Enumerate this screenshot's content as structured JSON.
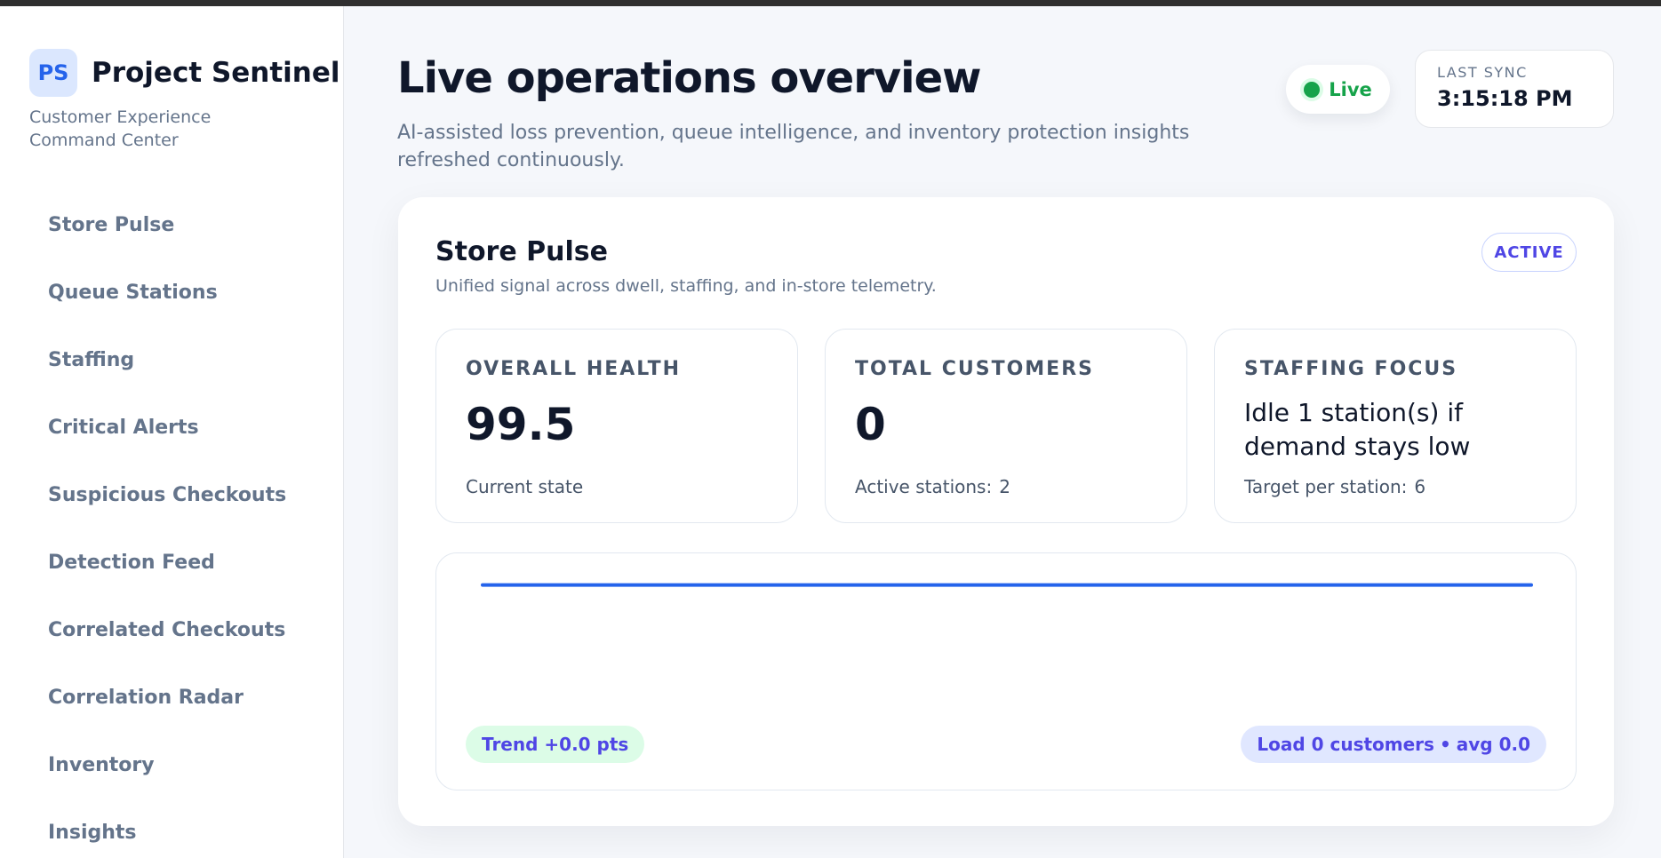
{
  "app": {
    "initials": "PS",
    "name": "Project Sentinel",
    "subtitle": "Customer Experience Command Center"
  },
  "sidebar": {
    "items": [
      {
        "label": "Store Pulse"
      },
      {
        "label": "Queue Stations"
      },
      {
        "label": "Staffing"
      },
      {
        "label": "Critical Alerts"
      },
      {
        "label": "Suspicious Checkouts"
      },
      {
        "label": "Detection Feed"
      },
      {
        "label": "Correlated Checkouts"
      },
      {
        "label": "Correlation Radar"
      },
      {
        "label": "Inventory"
      },
      {
        "label": "Insights"
      }
    ]
  },
  "header": {
    "title": "Live operations overview",
    "subtitle": "AI-assisted loss prevention, queue intelligence, and inventory protection insights refreshed continuously.",
    "live_label": "Live",
    "sync_label": "LAST SYNC",
    "sync_time": "3:15:18 PM"
  },
  "card": {
    "title": "Store Pulse",
    "subtitle": "Unified signal across dwell, staffing, and in-store telemetry.",
    "badge": "ACTIVE",
    "metrics": [
      {
        "label": "OVERALL HEALTH",
        "value": "99.5",
        "foot_label": "Current state",
        "foot_value": ""
      },
      {
        "label": "TOTAL CUSTOMERS",
        "value": "0",
        "foot_label": "Active stations:",
        "foot_value": "2"
      },
      {
        "label": "STAFFING FOCUS",
        "value": "Idle 1 station(s) if demand stays low",
        "foot_label": "Target per station:",
        "foot_value": "6"
      }
    ],
    "trend_label": "Trend +0.0 pts",
    "load_label": "Load 0 customers",
    "load_sep": "•",
    "load_avg": "avg 0.0"
  },
  "colors": {
    "accent": "#2563eb",
    "live": "#16a34a",
    "badge": "#4f46e5"
  },
  "icons": {
    "live": "status-dot-icon"
  },
  "sparkline": {
    "values": [
      99.5,
      99.5,
      99.5,
      99.5,
      99.5,
      99.5,
      99.5,
      99.5,
      99.5,
      99.5,
      99.5,
      99.5
    ]
  }
}
